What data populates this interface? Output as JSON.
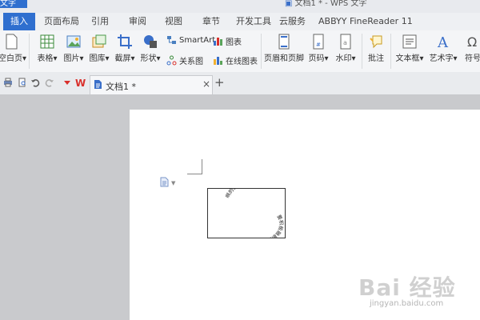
{
  "titlebar": {
    "app_button": "文字",
    "doc_title": "文档1 * - WPS 文字"
  },
  "menu": {
    "tabs": [
      "插入",
      "页面布局",
      "引用",
      "审阅",
      "视图",
      "章节",
      "开发工具",
      "云服务",
      "ABBYY FineReader 11"
    ],
    "active": "插入"
  },
  "ribbon": {
    "blank_page": "空白页",
    "table": "表格",
    "picture": "图片",
    "gallery": "图库",
    "screenshot": "截屏",
    "shape": "形状",
    "smartart": "SmartArt",
    "chart": "图表",
    "relation": "关系图",
    "online_chart": "在线图表",
    "header_footer": "页眉和页脚",
    "page_number": "页码",
    "watermark": "水印",
    "comment": "批注",
    "textbox": "文本框",
    "wordart": "艺术字",
    "symbol": "符号"
  },
  "doc_tab": {
    "label": "文档1 *",
    "close": "×",
    "new": "+"
  },
  "document": {
    "textbox_top_text": "啊的速度十分比较迅速",
    "textbox_bottom_text": "要积极融新能力创造力"
  },
  "watermark": {
    "main": "Bai 经验",
    "sub": "jingyan.baidu.com"
  },
  "colors": {
    "accent": "#2f6fcf",
    "ribbon_bg": "#f4f5f7",
    "workspace": "#c9cacd",
    "wps_red": "#d9302c"
  }
}
